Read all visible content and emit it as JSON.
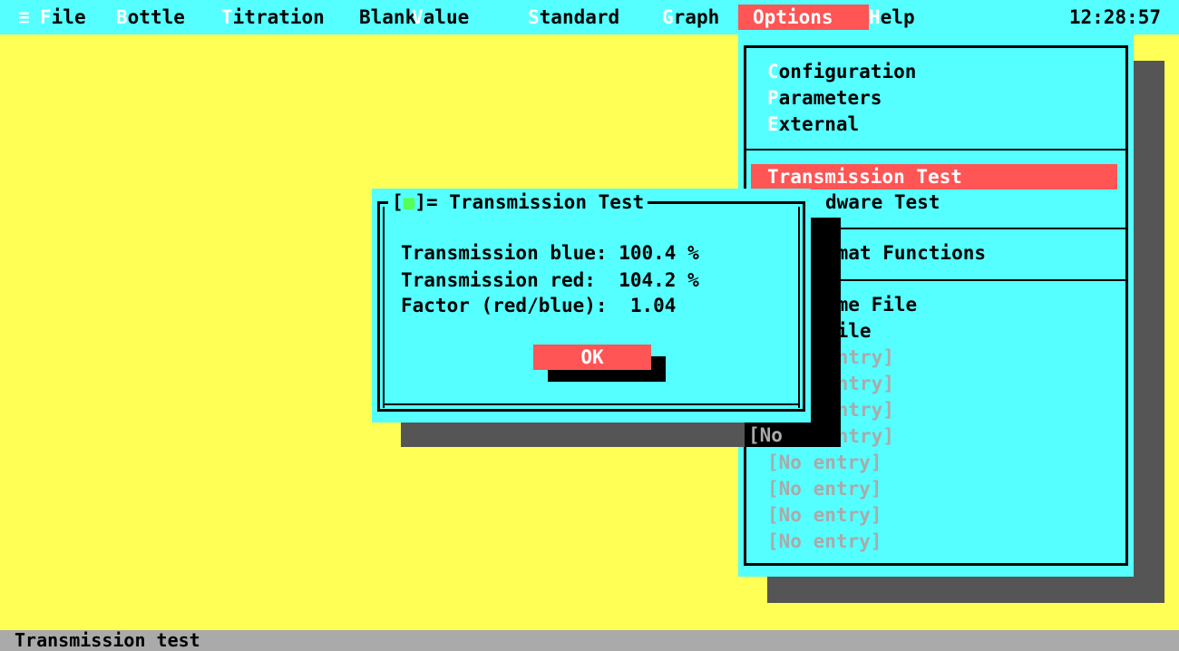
{
  "menubar": {
    "system_icon": "≡",
    "items": [
      {
        "hotkey": "F",
        "rest": "ile"
      },
      {
        "hotkey": "B",
        "rest": "ottle"
      },
      {
        "hotkey": "T",
        "rest": "itration"
      },
      {
        "hotkey": "",
        "rest": "Blank"
      },
      {
        "hotkey": "V",
        "rest": "alue"
      },
      {
        "hotkey": "S",
        "rest": "tandard"
      },
      {
        "hotkey": "G",
        "rest": "raph"
      },
      {
        "hotkey": "",
        "rest": "Options"
      },
      {
        "hotkey": "H",
        "rest": "elp"
      }
    ],
    "clock": "12:28:57"
  },
  "options_menu": {
    "group1": [
      {
        "hotkey": "C",
        "rest": "onfiguration"
      },
      {
        "hotkey": "P",
        "rest": "arameters"
      },
      {
        "hotkey": "E",
        "rest": "xternal"
      }
    ],
    "selected": "Transmission Test",
    "visible_items": [
      "dware Test",
      "imat Functions",
      "dme File",
      "File"
    ],
    "partial_entries": [
      "entry]",
      "entry]",
      "entry]",
      "entry]"
    ],
    "no_entries": [
      "[No",
      "[No entry]",
      "[No entry]",
      "[No entry]",
      "[No entry]"
    ]
  },
  "dialog": {
    "title_open": "[",
    "close_glyph": "■",
    "title_rest": "]= Transmission Test",
    "lines": [
      "Transmission blue: 100.4 %",
      "Transmission red:  104.2 %",
      "Factor (red/blue):  1.04"
    ],
    "ok_label": "OK"
  },
  "statusbar": {
    "text": "Transmission test"
  },
  "colors": {
    "desktop": "#ffff55",
    "panel": "#55ffff",
    "highlight": "#ff5555",
    "shadow": "#555555",
    "status": "#aaaaaa"
  }
}
